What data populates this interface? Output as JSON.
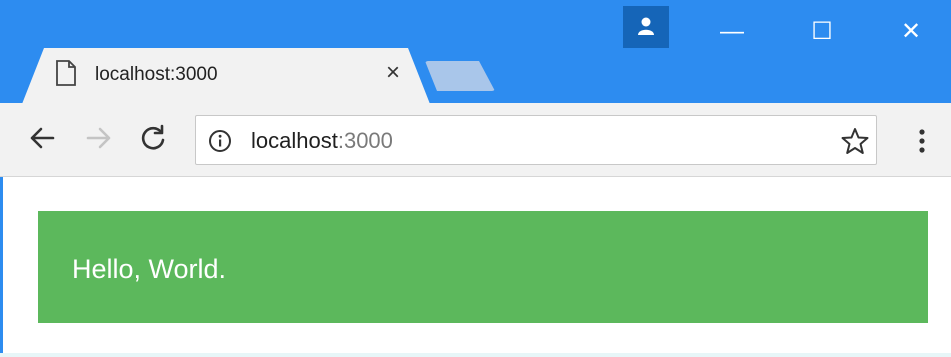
{
  "browser": {
    "tab": {
      "title": "localhost:3000",
      "close_glyph": "×",
      "icon": "page-icon"
    },
    "window_controls": {
      "minimize": "—",
      "maximize": "☐",
      "close": "✕"
    },
    "toolbar": {
      "back_icon": "back-arrow-icon",
      "forward_icon": "forward-arrow-icon",
      "reload_icon": "reload-icon",
      "address": {
        "host": "localhost",
        "port": ":3000"
      },
      "info_icon": "info-icon",
      "bookmark_icon": "star-icon",
      "menu_icon": "kebab-menu-icon"
    }
  },
  "page": {
    "alert_text": "Hello, World.",
    "alert_color": "#5cb85c"
  },
  "colors": {
    "titlebar": "#2d8cf0",
    "toolbar": "#f2f2f2",
    "profile": "#1565b8"
  }
}
